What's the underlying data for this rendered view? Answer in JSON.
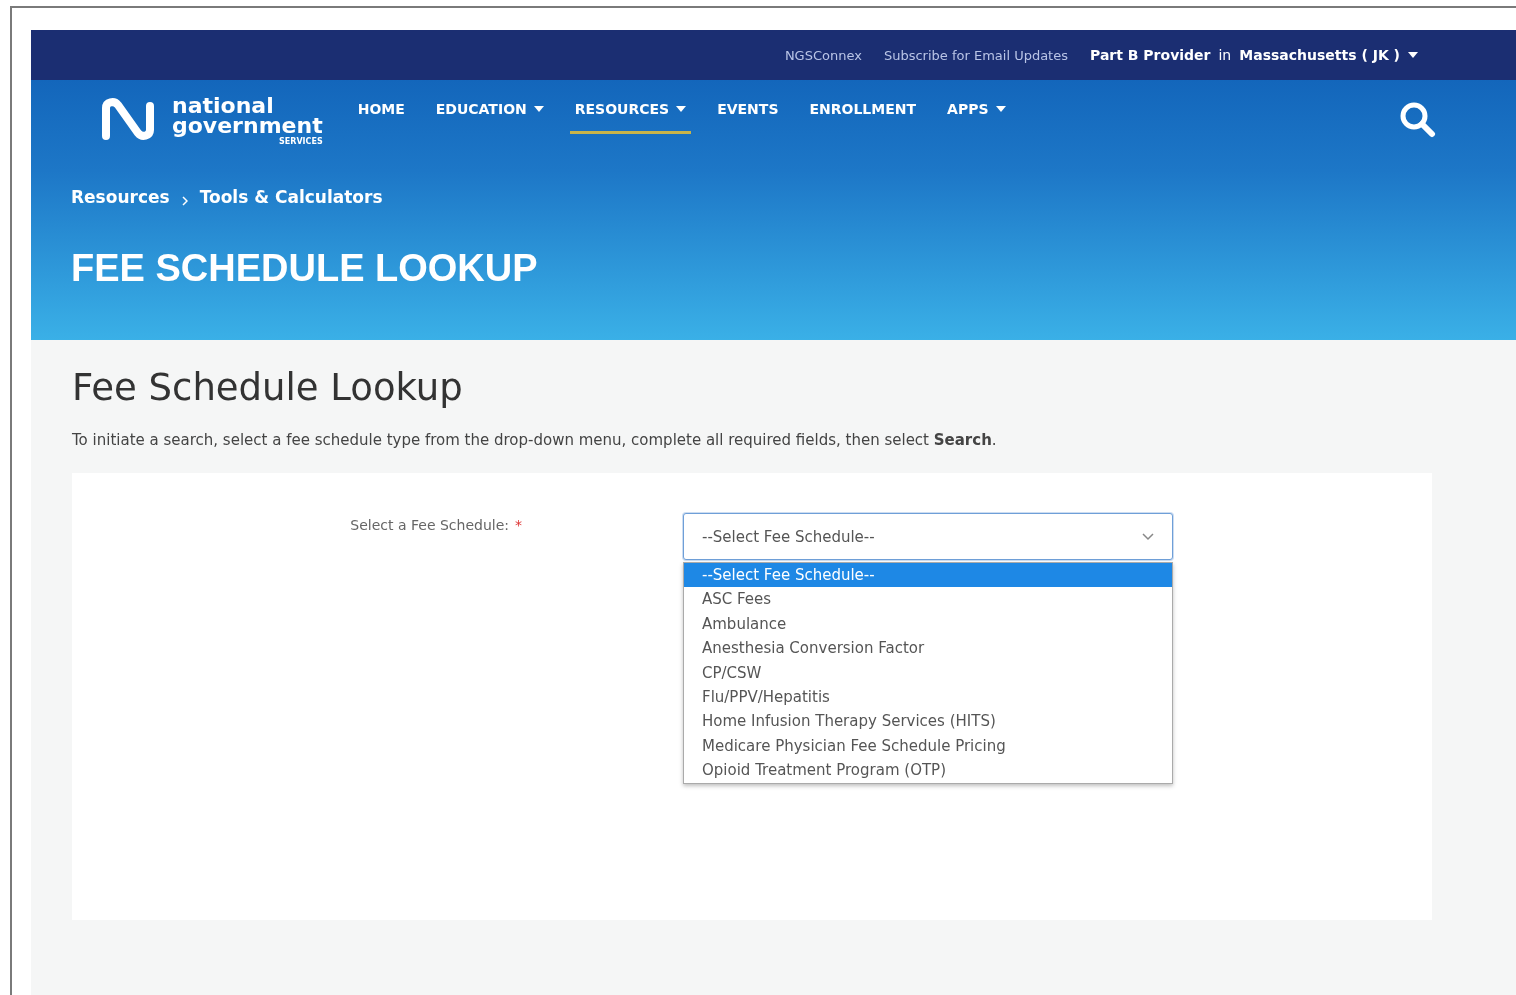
{
  "top_bar": {
    "links": [
      "NGSConnex",
      "Subscribe for Email Updates"
    ],
    "region_selector": "**Part B Provider** in **Massachusetts ( JK )**"
  },
  "logo": {
    "line_1": "national",
    "line_2": "government",
    "line_3": "SERVICES"
  },
  "nav": [
    {
      "label": "HOME",
      "dropdown": false,
      "selected": false
    },
    {
      "label": "EDUCATION",
      "dropdown": true,
      "selected": false
    },
    {
      "label": "RESOURCES",
      "dropdown": true,
      "selected": true
    },
    {
      "label": "EVENTS",
      "dropdown": false,
      "selected": false
    },
    {
      "label": "ENROLLMENT",
      "dropdown": false,
      "selected": false
    },
    {
      "label": "APPS",
      "dropdown": true,
      "selected": false
    }
  ],
  "breadcrumb": [
    "Resources",
    "Tools & Calculators"
  ],
  "hero_title": "FEE SCHEDULE LOOKUP",
  "page_heading": "Fee Schedule Lookup",
  "instructions": "To initiate a search, select a fee schedule type from the drop-down menu, complete all required fields, then select **Search**.",
  "form": {
    "label": "Select a Fee Schedule:",
    "required_mark": "*",
    "select": {
      "value": "--Select Fee Schedule--",
      "expanded": true,
      "options": [
        {
          "label": "--Select Fee Schedule--",
          "selected": true
        },
        {
          "label": "ASC Fees",
          "selected": false
        },
        {
          "label": "Ambulance",
          "selected": false
        },
        {
          "label": "Anesthesia Conversion Factor",
          "selected": false
        },
        {
          "label": "CP/CSW",
          "selected": false
        },
        {
          "label": "Flu/PPV/Hepatitis",
          "selected": false
        },
        {
          "label": "Home Infusion Therapy Services (HITS)",
          "selected": false
        },
        {
          "label": "Medicare Physician Fee Schedule Pricing",
          "selected": false
        },
        {
          "label": "Opioid Treatment Program (OTP)",
          "selected": false
        }
      ]
    }
  }
}
